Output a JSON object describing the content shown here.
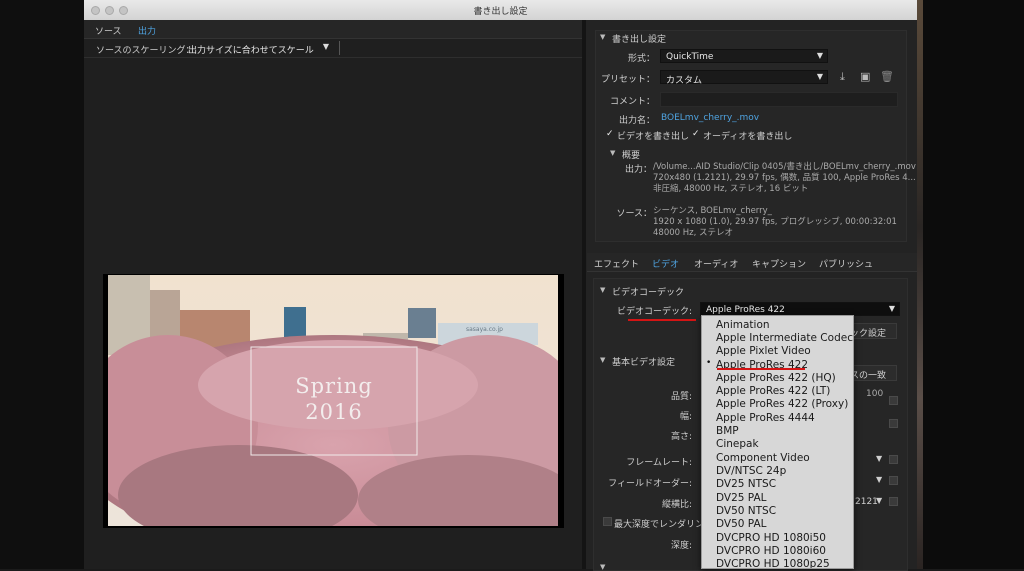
{
  "window": {
    "title": "書き出し設定"
  },
  "left_panel": {
    "tabs": [
      {
        "label": "ソース"
      },
      {
        "label": "出力"
      }
    ],
    "scaling_label": "ソースのスケーリング：",
    "scaling_value": "出力サイズに合わせてスケール",
    "preview": {
      "overlay_line1": "Spring",
      "overlay_line2": "2016",
      "sign_text": "sasaya.co.jp"
    }
  },
  "export_settings": {
    "section_title": "書き出し設定",
    "format_label": "形式：",
    "format_value": "QuickTime",
    "preset_label": "プリセット：",
    "preset_value": "カスタム",
    "comment_label": "コメント：",
    "output_name_label": "出力名：",
    "output_name_value": "BOELmv_cherry_.mov",
    "export_video_label": "ビデオを書き出し",
    "export_audio_label": "オーディオを書き出し",
    "summary": {
      "title": "概要",
      "output_label": "出力：",
      "output_lines": [
        "/Volume...AID Studio/Clip 0405/書き出し/BOELmv_cherry_.mov",
        "720x480 (1.2121), 29.97 fps, 偶数, 品質 100, Apple ProRes 4...",
        "非圧縮, 48000 Hz, ステレオ, 16 ビット"
      ],
      "source_label": "ソース：",
      "source_lines": [
        "シーケンス, BOELmv_cherry_",
        "1920 x 1080 (1.0), 29.97 fps, プログレッシブ, 00:00:32:01",
        "48000 Hz, ステレオ"
      ]
    }
  },
  "settings_tabs": [
    {
      "label": "エフェクト"
    },
    {
      "label": "ビデオ"
    },
    {
      "label": "オーディオ"
    },
    {
      "label": "キャプション"
    },
    {
      "label": "パブリッシュ"
    }
  ],
  "video": {
    "codec_section": "ビデオコーデック",
    "codec_label": "ビデオコーデック:",
    "codec_value": "Apple ProRes 422",
    "codec_settings_partial": "ック設定",
    "basic_section": "基本ビデオ設定",
    "match_source_partial": "スの一致",
    "quality_label": "品質:",
    "quality_value": "100",
    "width_label": "幅:",
    "height_label": "高さ:",
    "framerate_label": "フレームレート:",
    "field_order_label": "フィールドオーダー:",
    "aspect_label": "縦横比:",
    "aspect_value_partial": "2121",
    "max_depth_label": "最大深度でレンダリング",
    "depth_label": "深度:"
  },
  "codec_dropdown": {
    "selected": "Apple ProRes 422",
    "options": [
      "Animation",
      "Apple Intermediate Codec",
      "Apple Pixlet Video",
      "Apple ProRes 422",
      "Apple ProRes 422 (HQ)",
      "Apple ProRes 422 (LT)",
      "Apple ProRes 422 (Proxy)",
      "Apple ProRes 4444",
      "BMP",
      "Cinepak",
      "Component Video",
      "DV/NTSC 24p",
      "DV25 NTSC",
      "DV25 PAL",
      "DV50 NTSC",
      "DV50 PAL",
      "DVCPRO HD 1080i50",
      "DVCPRO HD 1080i60",
      "DVCPRO HD 1080p25"
    ]
  },
  "colors": {
    "accent": "#4fa3e0",
    "annotation": "#d41414"
  }
}
